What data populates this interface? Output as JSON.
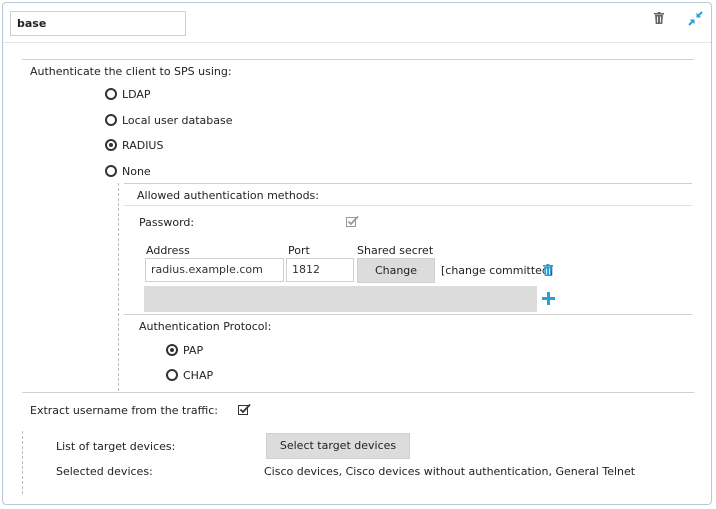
{
  "header": {
    "name_value": "base",
    "delete_icon": "trash-icon",
    "collapse_icon": "compress-arrows-icon"
  },
  "auth": {
    "label": "Authenticate the client to SPS using:",
    "options": [
      {
        "label": "LDAP",
        "selected": false
      },
      {
        "label": "Local user database",
        "selected": false
      },
      {
        "label": "RADIUS",
        "selected": true
      },
      {
        "label": "None",
        "selected": false
      }
    ]
  },
  "allowed_methods": {
    "label": "Allowed authentication methods:",
    "password_label": "Password:",
    "password_checked": true
  },
  "radius_table": {
    "headers": {
      "address": "Address",
      "port": "Port",
      "secret": "Shared secret"
    },
    "row": {
      "address": "radius.example.com",
      "port": "1812",
      "change_label": "Change",
      "status": "[change committed]"
    },
    "add_icon": "plus-icon",
    "remove_icon": "trash-icon"
  },
  "protocol": {
    "label": "Authentication Protocol:",
    "options": [
      {
        "label": "PAP",
        "selected": true
      },
      {
        "label": "CHAP",
        "selected": false
      }
    ]
  },
  "extract": {
    "label": "Extract username from the traffic:",
    "checked": true
  },
  "targets": {
    "list_label": "List of target devices:",
    "select_button": "Select target devices",
    "selected_label": "Selected devices:",
    "selected_value": "Cisco devices, Cisco devices without authentication, General Telnet"
  },
  "colors": {
    "accent": "#2a9fd6",
    "icon_gray": "#666666"
  }
}
